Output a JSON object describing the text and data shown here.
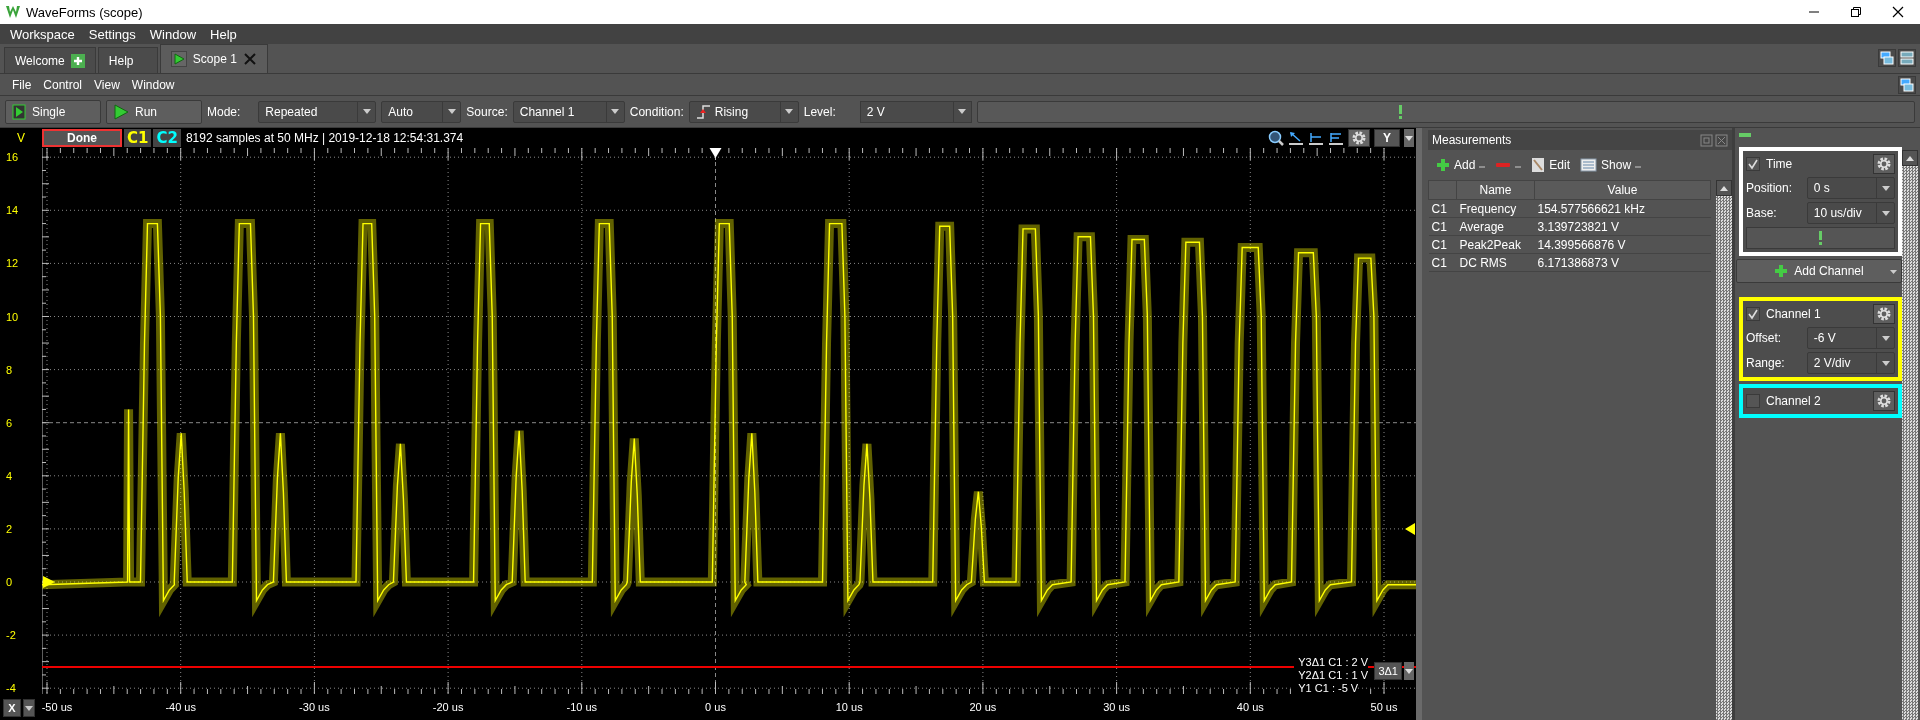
{
  "window": {
    "title": "WaveForms (scope)"
  },
  "menu": [
    "Workspace",
    "Settings",
    "Window",
    "Help"
  ],
  "tabs": [
    {
      "label": "Welcome",
      "selected": false,
      "kind": "add"
    },
    {
      "label": "Help",
      "selected": false,
      "kind": "plain"
    },
    {
      "label": "Scope 1",
      "selected": true,
      "kind": "run"
    }
  ],
  "scope_menu": [
    "File",
    "Control",
    "View",
    "Window"
  ],
  "toolbar": {
    "single": "Single",
    "run": "Run",
    "mode_label": "Mode:",
    "mode": "Repeated",
    "auto": "Auto",
    "source_label": "Source:",
    "source": "Channel 1",
    "condition_label": "Condition:",
    "condition": "Rising",
    "level_label": "Level:",
    "level": "2 V"
  },
  "plot": {
    "unit": "V",
    "status": "Done",
    "channels": [
      {
        "label": "C1"
      },
      {
        "label": "C2"
      }
    ],
    "info": "8192 samples at 50 MHz | 2019-12-18 12:54:31.374",
    "y_button": "Y",
    "x_button": "X",
    "y_ticks": [
      "16",
      "14",
      "12",
      "10",
      "8",
      "6",
      "4",
      "2",
      "0",
      "-2",
      "-4"
    ],
    "x_ticks": [
      "-50 us",
      "-40 us",
      "-30 us",
      "-20 us",
      "-10 us",
      "0 us",
      "10 us",
      "20 us",
      "30 us",
      "40 us",
      "50 us"
    ],
    "cursors": [
      "Y3Δ1 C1 : 2 V",
      "Y2Δ1 C1 : 1 V",
      "Y1 C1 : -5 V"
    ],
    "cursor_button": "3Δ1"
  },
  "measurements": {
    "title": "Measurements",
    "add": "Add",
    "edit": "Edit",
    "show": "Show",
    "columns": [
      "Name",
      "Value"
    ],
    "rows": [
      {
        "channel": "C1",
        "name": "Frequency",
        "value": "154.577566621 kHz"
      },
      {
        "channel": "C1",
        "name": "Average",
        "value": "3.139723821 V"
      },
      {
        "channel": "C1",
        "name": "Peak2Peak",
        "value": "14.399566876 V"
      },
      {
        "channel": "C1",
        "name": "DC RMS",
        "value": "6.171386873 V"
      }
    ]
  },
  "panel": {
    "time": {
      "label": "Time",
      "checked": true,
      "fields": [
        {
          "label": "Position:",
          "value": "0 s"
        },
        {
          "label": "Base:",
          "value": "10 us/div"
        }
      ]
    },
    "add_channel": "Add Channel",
    "channels": [
      {
        "label": "Channel 1",
        "checked": true,
        "color": "#ffff00",
        "fields": [
          {
            "label": "Offset:",
            "value": "-6 V"
          },
          {
            "label": "Range:",
            "value": "2 V/div"
          }
        ]
      },
      {
        "label": "Channel 2",
        "checked": false,
        "color": "#00ffff"
      }
    ]
  }
}
